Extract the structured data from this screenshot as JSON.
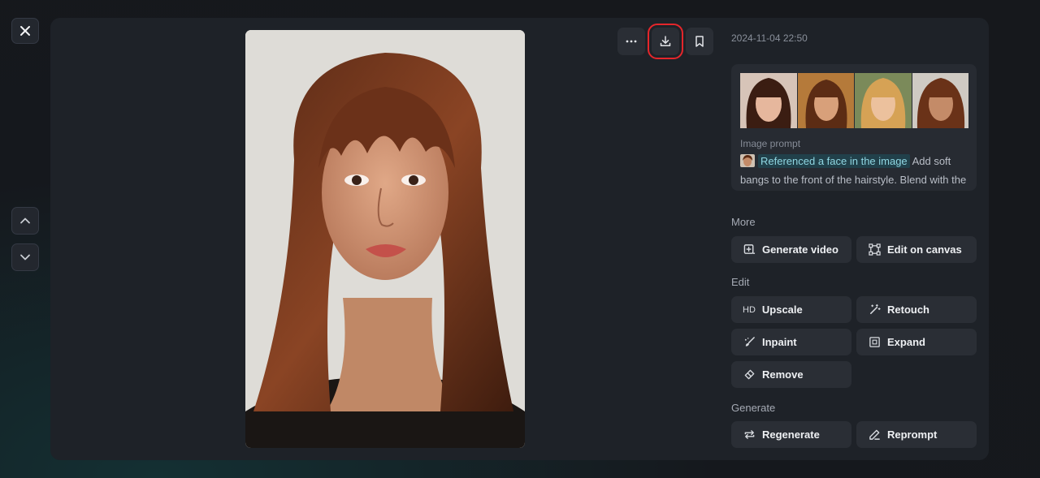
{
  "timestamp": "2024-11-04 22:50",
  "prompt": {
    "label": "Image prompt",
    "reference_chip": "Referenced a face in the image",
    "text": "Add soft bangs to the front of the hairstyle. Blend with the hair"
  },
  "sections": {
    "more": "More",
    "edit": "Edit",
    "generate": "Generate"
  },
  "actions": {
    "generate_video": "Generate video",
    "edit_on_canvas": "Edit on canvas",
    "upscale_badge": "HD",
    "upscale": "Upscale",
    "retouch": "Retouch",
    "inpaint": "Inpaint",
    "expand": "Expand",
    "remove": "Remove",
    "regenerate": "Regenerate",
    "reprompt": "Reprompt"
  },
  "icons": {
    "close": "close-icon",
    "up": "chevron-up-icon",
    "down": "chevron-down-icon",
    "more": "more-horizontal-icon",
    "download": "download-icon",
    "bookmark": "bookmark-icon"
  },
  "colors": {
    "accent_highlight": "#e5262b",
    "reference_chip_bg": "#21404a",
    "reference_chip_text": "#8fd6e2"
  }
}
